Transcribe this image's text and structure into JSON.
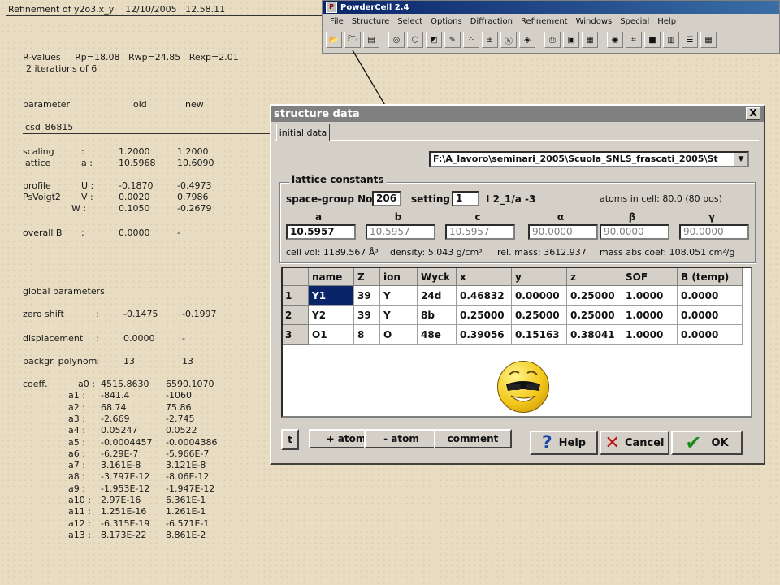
{
  "refinement": {
    "header": "Refinement of y2o3.x_y    12/10/2005   12.58.11",
    "rvalues": "R-values     Rp=18.08   Rwp=24.85   Rexp=2.01",
    "iterations": "2 iterations of 6",
    "col_param": "parameter",
    "col_old": "old",
    "col_new": "new",
    "phase": "icsd_86815",
    "rows": [
      {
        "name": "scaling",
        "sub": ":",
        "old": "1.2000",
        "new": "1.2000"
      },
      {
        "name": "lattice",
        "sub": "a :",
        "old": "10.5968",
        "new": "10.6090"
      },
      {
        "name": "profile",
        "sub": "U :",
        "old": "-0.1870",
        "new": "-0.4973"
      },
      {
        "name": "PsVoigt2",
        "sub": "V :",
        "old": "0.0020",
        "new": "0.7986"
      },
      {
        "name": "",
        "sub": "W :",
        "old": "0.1050",
        "new": "-0.2679"
      },
      {
        "name": "overall B",
        "sub": ":",
        "old": "0.0000",
        "new": "-"
      }
    ],
    "global_title": "global parameters",
    "global_rows": [
      {
        "name": "zero shift",
        "sub": ":",
        "old": "-0.1475",
        "new": "-0.1997"
      },
      {
        "name": "displacement",
        "sub": ":",
        "old": "0.0000",
        "new": "-"
      },
      {
        "name": "backgr. polynom",
        "sub": ":",
        "old": "13",
        "new": "13"
      }
    ],
    "coeff_label": "coeff.",
    "coeffs": [
      {
        "k": "a0 :",
        "old": "4515.8630",
        "new": "6590.1070"
      },
      {
        "k": "a1 :",
        "old": "-841.4",
        "new": "-1060"
      },
      {
        "k": "a2 :",
        "old": "68.74",
        "new": "75.86"
      },
      {
        "k": "a3 :",
        "old": "-2.669",
        "new": "-2.745"
      },
      {
        "k": "a4 :",
        "old": "0.05247",
        "new": "0.0522"
      },
      {
        "k": "a5 :",
        "old": "-0.0004457",
        "new": "-0.0004386"
      },
      {
        "k": "a6 :",
        "old": "-6.29E-7",
        "new": "-5.966E-7"
      },
      {
        "k": "a7 :",
        "old": "3.161E-8",
        "new": "3.121E-8"
      },
      {
        "k": "a8 :",
        "old": "-3.797E-12",
        "new": "-8.06E-12"
      },
      {
        "k": "a9 :",
        "old": "-1.953E-12",
        "new": "-1.947E-12"
      },
      {
        "k": "a10 :",
        "old": "2.97E-16",
        "new": "6.361E-1"
      },
      {
        "k": "a11 :",
        "old": "1.251E-16",
        "new": "1.261E-1"
      },
      {
        "k": "a12 :",
        "old": "-6.315E-19",
        "new": "-6.571E-1"
      },
      {
        "k": "a13 :",
        "old": "8.173E-22",
        "new": "8.861E-2"
      }
    ]
  },
  "powdercell": {
    "title": "PowderCell 2.4",
    "menu": [
      "File",
      "Structure",
      "Select",
      "Options",
      "Diffraction",
      "Refinement",
      "Windows",
      "Special",
      "Help"
    ],
    "toolbar_icons": [
      "open-folder-icon",
      "open-file-icon",
      "save-icon",
      "gap",
      "target-icon",
      "structure-icon",
      "diagram-icon",
      "edit-icon",
      "dots-icon",
      "ax-icon",
      "hkl-icon",
      "powder-icon",
      "gap",
      "print-icon",
      "print2-icon",
      "print3-icon",
      "gap",
      "globe-icon",
      "grid-icon",
      "color-icon",
      "book-icon",
      "list-icon",
      "table-icon"
    ]
  },
  "dialog": {
    "title": "structure data",
    "close": "X",
    "tab": "initial data",
    "path": "F:\\A_lavoro\\seminari_2005\\Scuola_SNLS_frascati_2005\\St",
    "lattice_legend": "lattice constants",
    "sg_label": "space-group No",
    "sg_value": "206",
    "setting_label": "setting",
    "setting_value": "1",
    "sg_symbol": "I 2_1/a -3",
    "atoms_in_cell": "atoms in cell: 80.0   (80 pos)",
    "lattice_headers": [
      "a",
      "b",
      "c",
      "α",
      "β",
      "γ"
    ],
    "lattice_values": [
      "10.5957",
      "10.5957",
      "10.5957",
      "90.0000",
      "90.0000",
      "90.0000"
    ],
    "cell_vol": "cell vol: 1189.567 Å³",
    "density": "density: 5.043 g/cm³",
    "rel_mass": "rel. mass: 3612.937",
    "mass_abs": "mass abs coef: 108.051 cm²/g",
    "grid_headers": [
      "name",
      "Z",
      "ion",
      "Wyck",
      "x",
      "y",
      "z",
      "SOF",
      "B (temp)"
    ],
    "grid_rows": [
      [
        "Y1",
        "39",
        "Y",
        "24d",
        "0.46832",
        "0.00000",
        "0.25000",
        "1.0000",
        "0.0000"
      ],
      [
        "Y2",
        "39",
        "Y",
        "8b",
        "0.25000",
        "0.25000",
        "0.25000",
        "1.0000",
        "0.0000"
      ],
      [
        "O1",
        "8",
        "O",
        "48e",
        "0.39056",
        "0.15163",
        "0.38041",
        "1.0000",
        "0.0000"
      ]
    ],
    "row_numbers": [
      "1",
      "2",
      "3"
    ],
    "btn_t": "t",
    "btn_add_atom": "+ atom",
    "btn_remove_atom": "- atom",
    "btn_comment": "comment",
    "btn_help": "Help",
    "btn_cancel": "Cancel",
    "btn_ok": "OK"
  }
}
